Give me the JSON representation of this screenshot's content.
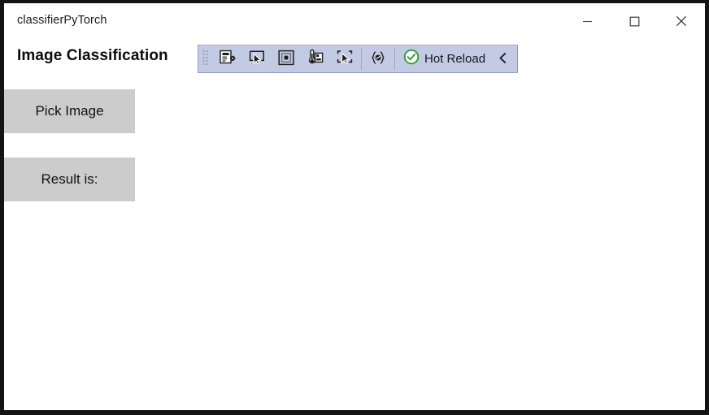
{
  "window": {
    "title": "classifierPyTorch",
    "controls": [
      {
        "name": "minimize",
        "icon": "minimize-icon",
        "label": "Minimize"
      },
      {
        "name": "maximize",
        "icon": "maximize-icon",
        "label": "Maximize"
      },
      {
        "name": "close",
        "icon": "close-icon",
        "label": "Close"
      }
    ]
  },
  "page": {
    "heading": "Image Classification"
  },
  "toolbar": {
    "grip": "drag-grip-icon",
    "buttons": [
      {
        "name": "live-visual-tree",
        "icon": "live-visual-tree-icon",
        "tooltip": "Go to Live Visual Tree"
      },
      {
        "name": "select-element",
        "icon": "select-element-icon",
        "tooltip": "Select Element"
      },
      {
        "name": "display-layout-adorners",
        "icon": "layout-adorner-icon",
        "tooltip": "Display Layout Adorners"
      },
      {
        "name": "track-focused-element",
        "icon": "track-focus-icon",
        "tooltip": "Track Focused Element"
      },
      {
        "name": "show-in-live-visual-tree",
        "icon": "show-in-tree-icon",
        "tooltip": "Show in Live Visual Tree"
      },
      {
        "name": "xaml-hot-reload",
        "icon": "xaml-braces-icon",
        "tooltip": "XAML Hot Reload"
      }
    ],
    "hot_reload": {
      "status_icon": "check-circle-icon",
      "label": "Hot Reload"
    },
    "collapse_icon": "chevron-left-icon"
  },
  "content": {
    "buttons": [
      {
        "name": "pick-image-button",
        "label": "Pick Image"
      },
      {
        "name": "result-label-button",
        "label": "Result is:"
      }
    ]
  },
  "colors": {
    "window_border": "#141414",
    "toolbar_bg": "#c3cbe4",
    "toolbar_border": "#8e99bf",
    "button_bg": "#cccccc",
    "hot_reload_green": "#2e9e34",
    "text": "#111111"
  }
}
